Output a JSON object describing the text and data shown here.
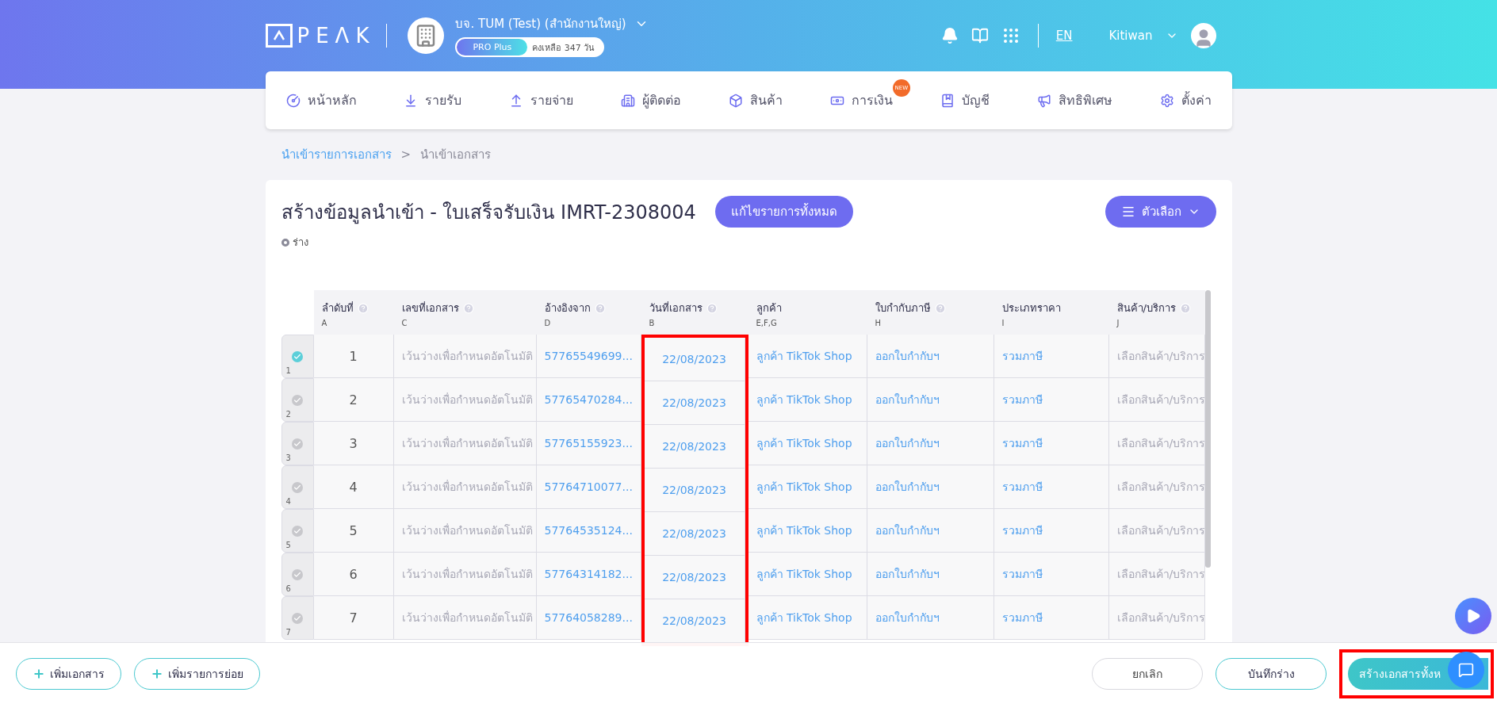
{
  "header": {
    "logo": "PEΛK",
    "company": "บจ. TUM (Test) (สำนักงานใหญ่)",
    "plan": "PRO Plus",
    "remaining": "คงเหลือ 347 วัน",
    "language": "EN",
    "user": "Kitiwan"
  },
  "nav": [
    {
      "label": "หน้าหลัก"
    },
    {
      "label": "รายรับ"
    },
    {
      "label": "รายจ่าย"
    },
    {
      "label": "ผู้ติดต่อ"
    },
    {
      "label": "สินค้า"
    },
    {
      "label": "การเงิน",
      "badge": "NEW"
    },
    {
      "label": "บัญชี"
    },
    {
      "label": "สิทธิพิเศษ"
    },
    {
      "label": "ตั้งค่า"
    }
  ],
  "breadcrumb": [
    {
      "label": "นำเข้ารายการเอกสาร",
      "link": true
    },
    {
      "label": ">",
      "link": false
    },
    {
      "label": "นำเข้าเอกสาร",
      "link": false
    }
  ],
  "title": "สร้างข้อมูลนำเข้า - ใบเสร็จรับเงิน IMRT-2308004",
  "edit_all_button": "แก้ไขรายการทั้งหมด",
  "options_button": "ตัวเลือก",
  "status": "ร่าง",
  "table": {
    "columns": [
      {
        "label": "ลำดับที่",
        "letter": "A",
        "help": true,
        "kind": "index",
        "highlighted": false
      },
      {
        "label": "เลขที่เอกสาร",
        "letter": "C",
        "help": true,
        "kind": "hint",
        "highlighted": false
      },
      {
        "label": "อ้างอิงจาก",
        "letter": "D",
        "help": true,
        "kind": "link",
        "highlighted": false
      },
      {
        "label": "วันที่เอกสาร",
        "letter": "B",
        "help": true,
        "kind": "link",
        "highlighted": true
      },
      {
        "label": "ลูกค้า",
        "letter": "E,F,G",
        "help": false,
        "kind": "link",
        "highlighted": false
      },
      {
        "label": "ใบกำกับภาษี",
        "letter": "H",
        "help": true,
        "kind": "link",
        "highlighted": false
      },
      {
        "label": "ประเภทราคา",
        "letter": "I",
        "help": false,
        "kind": "link",
        "highlighted": false
      },
      {
        "label": "สินค้า/บริการ",
        "letter": "J",
        "help": true,
        "kind": "hint",
        "highlighted": false
      }
    ],
    "rows": [
      {
        "row_no": "1",
        "checked": true,
        "cells": [
          "1",
          "เว้นว่างเพื่อกำหนดอัตโนมัติ",
          "57765549699...",
          "22/08/2023",
          "ลูกค้า TikTok Shop",
          "ออกใบกำกับฯ",
          "รวมภาษี",
          "เลือกสินค้า/บริการ"
        ]
      },
      {
        "row_no": "2",
        "checked": false,
        "cells": [
          "2",
          "เว้นว่างเพื่อกำหนดอัตโนมัติ",
          "57765470284...",
          "22/08/2023",
          "ลูกค้า TikTok Shop",
          "ออกใบกำกับฯ",
          "รวมภาษี",
          "เลือกสินค้า/บริการ"
        ]
      },
      {
        "row_no": "3",
        "checked": false,
        "cells": [
          "3",
          "เว้นว่างเพื่อกำหนดอัตโนมัติ",
          "57765155923...",
          "22/08/2023",
          "ลูกค้า TikTok Shop",
          "ออกใบกำกับฯ",
          "รวมภาษี",
          "เลือกสินค้า/บริการ"
        ]
      },
      {
        "row_no": "4",
        "checked": false,
        "cells": [
          "4",
          "เว้นว่างเพื่อกำหนดอัตโนมัติ",
          "57764710077...",
          "22/08/2023",
          "ลูกค้า TikTok Shop",
          "ออกใบกำกับฯ",
          "รวมภาษี",
          "เลือกสินค้า/บริการ"
        ]
      },
      {
        "row_no": "5",
        "checked": false,
        "cells": [
          "5",
          "เว้นว่างเพื่อกำหนดอัตโนมัติ",
          "57764535124...",
          "22/08/2023",
          "ลูกค้า TikTok Shop",
          "ออกใบกำกับฯ",
          "รวมภาษี",
          "เลือกสินค้า/บริการ"
        ]
      },
      {
        "row_no": "6",
        "checked": false,
        "cells": [
          "6",
          "เว้นว่างเพื่อกำหนดอัตโนมัติ",
          "57764314182...",
          "22/08/2023",
          "ลูกค้า TikTok Shop",
          "ออกใบกำกับฯ",
          "รวมภาษี",
          "เลือกสินค้า/บริการ"
        ]
      },
      {
        "row_no": "7",
        "checked": false,
        "cells": [
          "7",
          "เว้นว่างเพื่อกำหนดอัตโนมัติ",
          "57764058289...",
          "22/08/2023",
          "ลูกค้า TikTok Shop",
          "ออกใบกำกับฯ",
          "รวมภาษี",
          "เลือกสินค้า/บริการ"
        ]
      }
    ]
  },
  "footer": {
    "left_buttons": [
      "เพิ่มเอกสาร",
      "เพิ่มรายการย่อย"
    ],
    "cancel": "ยกเลิก",
    "save_draft": "บันทึกร่าง",
    "create": {
      "label": "สร้างเอกสารทั้งห",
      "highlighted": true
    }
  }
}
